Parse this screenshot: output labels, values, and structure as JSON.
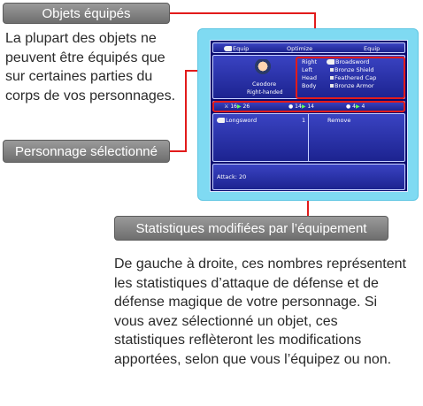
{
  "callouts": {
    "equipped_label": "Objets équipés",
    "equipped_text": "La plupart des objets ne peuvent être équipés que sur certaines parties du corps de vos personnages.",
    "selected_label": "Personnage sélectionné",
    "stats_label": "Statistiques modifiées par l’équipement",
    "stats_text": "De gauche à droite, ces nombres représentent les statistiques d’attaque de défense et de défense magique de votre personnage. Si vous avez sélectionné un objet, ces statistiques reflèteront les modifications apportées, selon que vous l’équipez ou non."
  },
  "game": {
    "tabs": [
      "Equip",
      "Optimize",
      "Equip"
    ],
    "character": {
      "name": "Ceodore",
      "hand_label": "Right-handed"
    },
    "slots": [
      {
        "part": "Right",
        "item": "Broadsword"
      },
      {
        "part": "Left",
        "item": "Bronze Shield"
      },
      {
        "part": "Head",
        "item": "Feathered Cap"
      },
      {
        "part": "Body",
        "item": "Bronze Armor"
      }
    ],
    "stats": [
      {
        "from": "16",
        "to": "26"
      },
      {
        "from": "14",
        "to": "14"
      },
      {
        "from": "4",
        "to": "4"
      }
    ],
    "inventory": [
      {
        "item": "Longsword",
        "qty": "1"
      }
    ],
    "remove_label": "Remove",
    "info": "Attack: 20"
  },
  "colors": {
    "accent_line": "#e21b1b",
    "screen_bg": "#0b0b6e",
    "frame": "#7fdaf2"
  }
}
